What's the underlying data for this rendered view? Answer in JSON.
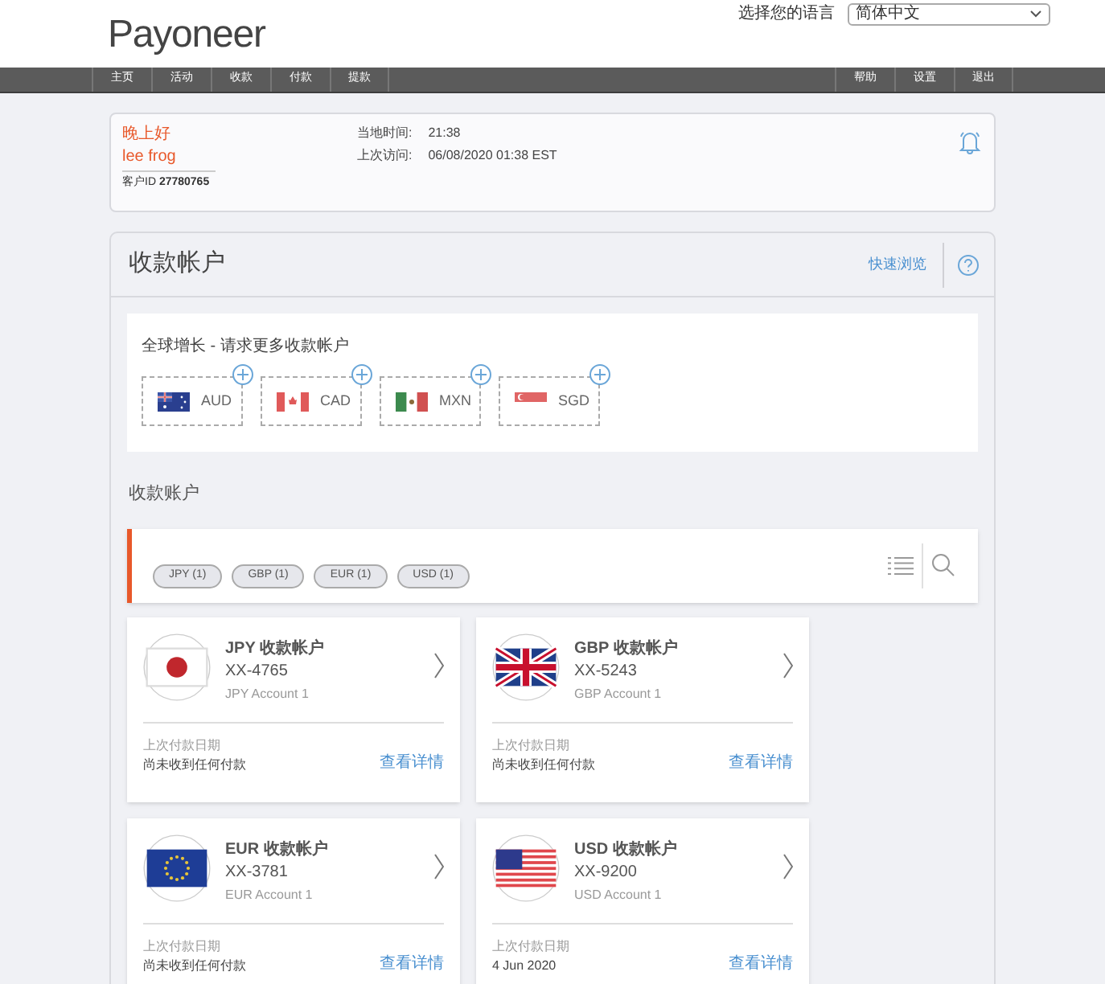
{
  "header": {
    "logo": "Payoneer",
    "language_label": "选择您的语言",
    "language_value": "简体中文"
  },
  "nav": {
    "left": [
      {
        "label": "主页"
      },
      {
        "label": "活动"
      },
      {
        "label": "收款"
      },
      {
        "label": "付款"
      },
      {
        "label": "提款"
      }
    ],
    "right": [
      {
        "label": "帮助"
      },
      {
        "label": "设置"
      },
      {
        "label": "退出"
      }
    ]
  },
  "greeting": {
    "hello": "晚上好",
    "name": "lee frog",
    "customer_id_label": "客户ID",
    "customer_id": "27780765",
    "local_time_label": "当地时间:",
    "local_time": "21:38",
    "last_visit_label": "上次访问:",
    "last_visit": "06/08/2020 01:38 EST"
  },
  "panel": {
    "title": "收款帐户",
    "quick_link": "快速浏览",
    "request_title": "全球增长 - 请求更多收款帐户",
    "request_currencies": [
      {
        "code": "AUD"
      },
      {
        "code": "CAD"
      },
      {
        "code": "MXN"
      },
      {
        "code": "SGD"
      }
    ],
    "accounts_title": "收款账户",
    "filters": [
      {
        "label": "JPY (1)"
      },
      {
        "label": "GBP (1)"
      },
      {
        "label": "EUR (1)"
      },
      {
        "label": "USD (1)"
      }
    ],
    "accounts": [
      {
        "title": "JPY 收款帐户",
        "number": "XX-4765",
        "nickname": "JPY Account 1",
        "last_label": "上次付款日期",
        "last_value": "尚未收到任何付款",
        "link": "查看详情"
      },
      {
        "title": "GBP 收款帐户",
        "number": "XX-5243",
        "nickname": "GBP Account 1",
        "last_label": "上次付款日期",
        "last_value": "尚未收到任何付款",
        "link": "查看详情"
      },
      {
        "title": "EUR 收款帐户",
        "number": "XX-3781",
        "nickname": "EUR Account 1",
        "last_label": "上次付款日期",
        "last_value": "尚未收到任何付款",
        "link": "查看详情"
      },
      {
        "title": "USD 收款帐户",
        "number": "XX-9200",
        "nickname": "USD Account 1",
        "last_label": "上次付款日期",
        "last_value": "4 Jun 2020",
        "link": "查看详情"
      }
    ]
  }
}
